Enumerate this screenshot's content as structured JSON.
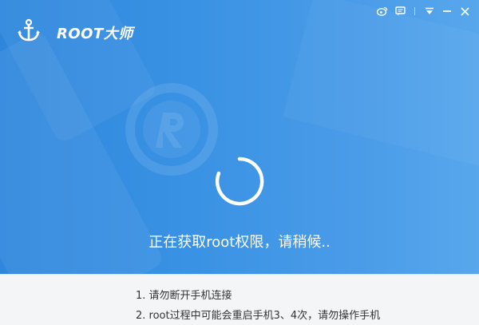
{
  "app": {
    "title": "ROOT大师"
  },
  "titlebar": {
    "icons": [
      "weibo-icon",
      "feedback-icon",
      "menu-dropdown-icon",
      "minimize-icon",
      "close-icon"
    ]
  },
  "status": {
    "text": "正在获取root权限，请稍候.."
  },
  "tips": [
    {
      "text": "1. 请勿断开手机连接"
    },
    {
      "text": "2. root过程中可能会重启手机3、4次，请勿操作手机"
    }
  ],
  "colors": {
    "primary_blue": "#3a92e4",
    "panel_bg": "#f3f5f7",
    "text_dark": "#333333",
    "text_light": "#ffffff"
  }
}
